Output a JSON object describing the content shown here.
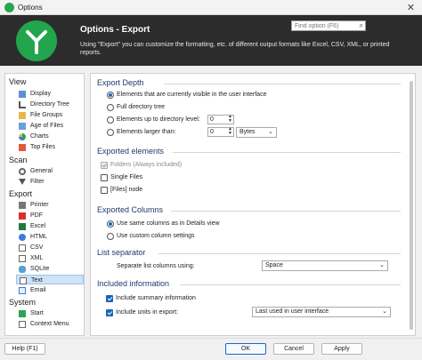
{
  "window": {
    "title": "Options",
    "close_glyph": "✕"
  },
  "header": {
    "title": "Options - Export",
    "description": "Using \"Export\" you can customize the formatting, etc. of different output formats like Excel, CSV, XML, or printed reports.",
    "search_placeholder": "Find option (F6)",
    "search_icon": "search-icon",
    "brand_color": "#22a54d"
  },
  "nav": {
    "categories": [
      {
        "label": "View",
        "items": [
          "Display",
          "Directory Tree",
          "File Groups",
          "Age of Files",
          "Charts",
          "Top Files"
        ]
      },
      {
        "label": "Scan",
        "items": [
          "General",
          "Filter"
        ]
      },
      {
        "label": "Export",
        "items": [
          "Printer",
          "PDF",
          "Excel",
          "HTML",
          "CSV",
          "XML",
          "SQLite",
          "Text",
          "Email"
        ]
      },
      {
        "label": "System",
        "items": [
          "Start",
          "Context Menu"
        ]
      }
    ],
    "selected": "Text"
  },
  "main": {
    "export_depth": {
      "heading": "Export Depth",
      "opt_visible": "Elements that are currently visible in the user interface",
      "opt_full": "Full directory tree",
      "opt_level": "Elements up to directory level:",
      "level_value": "0",
      "opt_larger": "Elements larger than:",
      "larger_value": "0",
      "unit_value": "Bytes"
    },
    "exported_elements": {
      "heading": "Exported elements",
      "folders": "Folders (Always included)",
      "single_files": "Single Files",
      "files_node": "[Files] node"
    },
    "exported_columns": {
      "heading": "Exported Columns",
      "same_columns": "Use same columns as in Details view",
      "custom_columns": "Use custom column settings"
    },
    "list_separator": {
      "heading": "List separator",
      "label": "Separate list columns using:",
      "value": "Space"
    },
    "included_information": {
      "heading": "Included information",
      "summary": "Include summary information",
      "units": "Include units in export:",
      "units_value": "Last used in user interface"
    }
  },
  "footer": {
    "help": "Help (F1)",
    "ok": "OK",
    "cancel": "Cancel",
    "apply": "Apply"
  }
}
